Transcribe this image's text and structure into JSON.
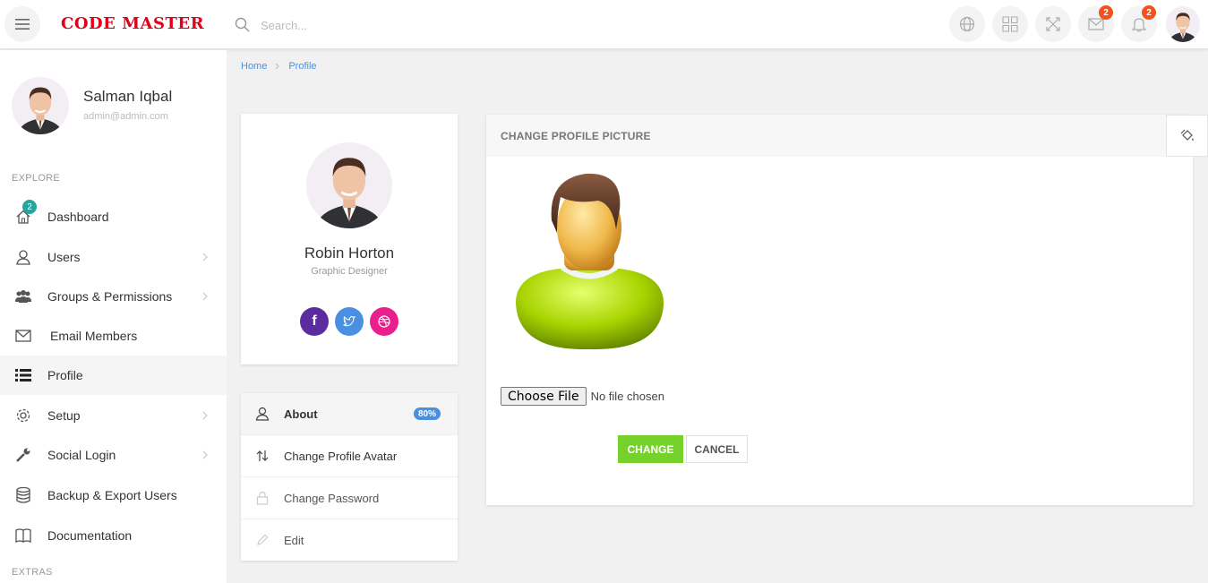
{
  "app": {
    "logo": "CODE MASTER"
  },
  "search": {
    "placeholder": "Search..."
  },
  "topbar": {
    "mail_count": "2",
    "notification_count": "2"
  },
  "sidebar": {
    "user_name": "Salman Iqbal",
    "user_email": "admin@admin.com",
    "explore_label": "EXPLORE",
    "extras_label": "EXTRAS",
    "items": [
      {
        "label": "Dashboard",
        "badge": "2"
      },
      {
        "label": "Users"
      },
      {
        "label": "Groups & Permissions"
      },
      {
        "label": "Email Members"
      },
      {
        "label": "Profile"
      },
      {
        "label": "Setup"
      },
      {
        "label": "Social Login"
      },
      {
        "label": "Backup & Export Users"
      },
      {
        "label": "Documentation"
      }
    ]
  },
  "breadcrumb": {
    "home": "Home",
    "current": "Profile"
  },
  "profile_card": {
    "name": "Robin Horton",
    "role": "Graphic Designer"
  },
  "profile_menu": [
    {
      "label": "About",
      "badge": "80%"
    },
    {
      "label": "Change Profile Avatar"
    },
    {
      "label": "Change Password"
    },
    {
      "label": "Edit"
    }
  ],
  "panel": {
    "title": "CHANGE PROFILE PICTURE",
    "choose_file_label": "Choose File",
    "no_file_text": "No file chosen",
    "change_label": "CHANGE",
    "cancel_label": "CANCEL"
  },
  "colors": {
    "logo": "#e0001a",
    "link": "#4a90e2",
    "badge_orange": "#f4511e",
    "badge_teal": "#26a69a",
    "change_button": "#76d12a",
    "facebook": "#5b2c9e",
    "twitter": "#4a90e2",
    "dribbble": "#ea1e8c"
  }
}
